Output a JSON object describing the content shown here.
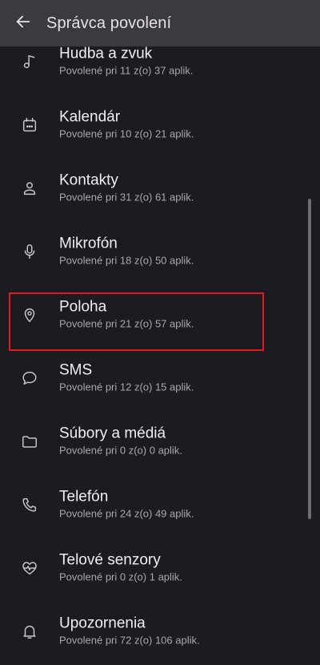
{
  "appbar": {
    "title": "Správca povolení",
    "back_icon": "arrow-left-icon"
  },
  "items": [
    {
      "title": "Hudba a zvuk",
      "subtitle": "Povolené pri 11 z(o) 37 aplik.",
      "icon": "music-note-icon"
    },
    {
      "title": "Kalendár",
      "subtitle": "Povolené pri 10 z(o) 21 aplik.",
      "icon": "calendar-icon"
    },
    {
      "title": "Kontakty",
      "subtitle": "Povolené pri 31 z(o) 61 aplik.",
      "icon": "person-icon"
    },
    {
      "title": "Mikrofón",
      "subtitle": "Povolené pri 18 z(o) 50 aplik.",
      "icon": "microphone-icon"
    },
    {
      "title": "Poloha",
      "subtitle": "Povolené pri 21 z(o) 57 aplik.",
      "icon": "location-pin-icon"
    },
    {
      "title": "SMS",
      "subtitle": "Povolené pri 12 z(o) 15 aplik.",
      "icon": "chat-bubble-icon"
    },
    {
      "title": "Súbory a médiá",
      "subtitle": "Povolené pri 0 z(o) 0 aplik.",
      "icon": "folder-icon"
    },
    {
      "title": "Telefón",
      "subtitle": "Povolené pri 24 z(o) 49 aplik.",
      "icon": "phone-icon"
    },
    {
      "title": "Telové senzory",
      "subtitle": "Povolené pri 0 z(o) 1 aplik.",
      "icon": "heart-pulse-icon"
    },
    {
      "title": "Upozornenia",
      "subtitle": "Povolené pri 72 z(o) 106 aplik.",
      "icon": "bell-icon"
    }
  ],
  "colors": {
    "background": "#1c1b1f",
    "appbar": "#3b3a3f",
    "highlight": "#e01b24",
    "title_text": "#f1eef2",
    "subtitle_text": "#aaa7ad"
  }
}
